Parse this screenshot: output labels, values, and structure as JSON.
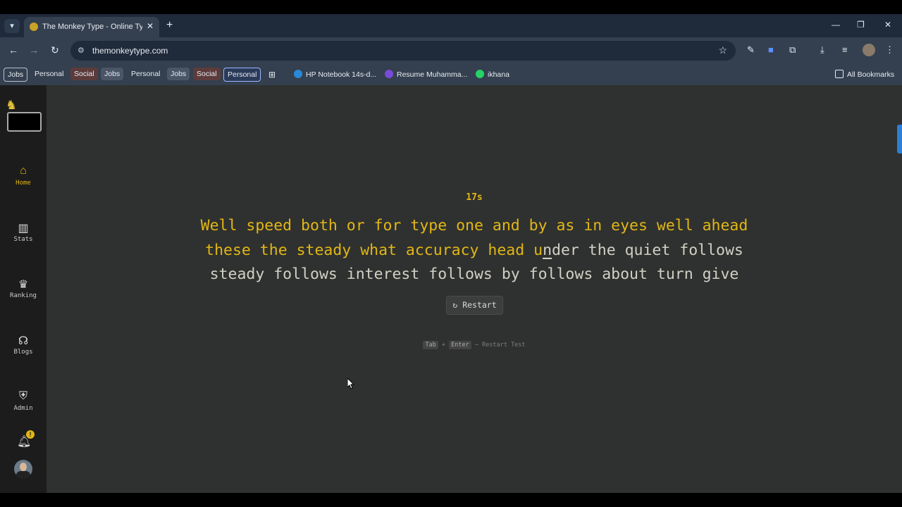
{
  "browser": {
    "tab_title": "The Monkey Type - Online Typing",
    "tab_close": "✕",
    "new_tab": "+",
    "url": "themonkeytype.com",
    "window_controls": [
      "—",
      "❐",
      "✕"
    ]
  },
  "bookmarks": {
    "items": [
      "Jobs",
      "Personal",
      "Social",
      "Jobs",
      "Personal",
      "Jobs",
      "Social",
      "Personal"
    ],
    "links": [
      "HP Notebook 14s-d...",
      "Resume Muhamma...",
      "ikhana"
    ],
    "all": "All Bookmarks"
  },
  "sidebar": {
    "items": [
      {
        "label": "Home",
        "icon": "home-icon"
      },
      {
        "label": "Stats",
        "icon": "stats-icon"
      },
      {
        "label": "Ranking",
        "icon": "trophy-icon"
      },
      {
        "label": "Blogs",
        "icon": "blog-icon"
      },
      {
        "label": "Admin",
        "icon": "admin-icon"
      }
    ],
    "notification_badge": "!"
  },
  "test": {
    "timer": "17s",
    "line1_typed": "Well speed both or for type one and by as in eyes well ahead",
    "line2_typed": "these the steady what accuracy head u",
    "line2_caret": "n",
    "line2_rest": "der the quiet follows",
    "line3": "steady follows interest follows by follows about turn give",
    "restart_label": "↻ Restart",
    "hint_key1": "Tab",
    "hint_plus": "+",
    "hint_key2": "Enter",
    "hint_text": "– Restart Test"
  },
  "colors": {
    "accent": "#e2b714",
    "background": "#2f3130",
    "text": "#d1d0c5"
  }
}
